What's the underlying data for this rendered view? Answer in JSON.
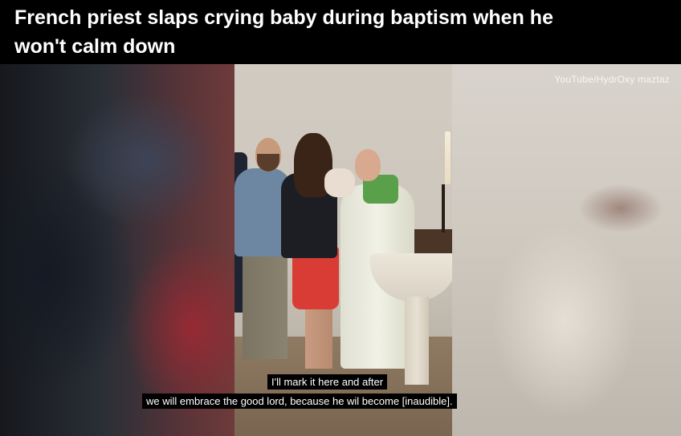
{
  "headline": {
    "line1": "French priest slaps crying baby during baptism when he",
    "line2": "won't calm down"
  },
  "video": {
    "watermark": "YouTube/HydrOxy maztaz",
    "captions": [
      "I'll mark it here and after",
      "we will embrace the good lord, because he wil become [inaudible]."
    ]
  },
  "colors": {
    "headline_bg": "#000000",
    "headline_text": "#ffffff",
    "caption_bg": "#000000",
    "caption_text": "#ffffff"
  }
}
